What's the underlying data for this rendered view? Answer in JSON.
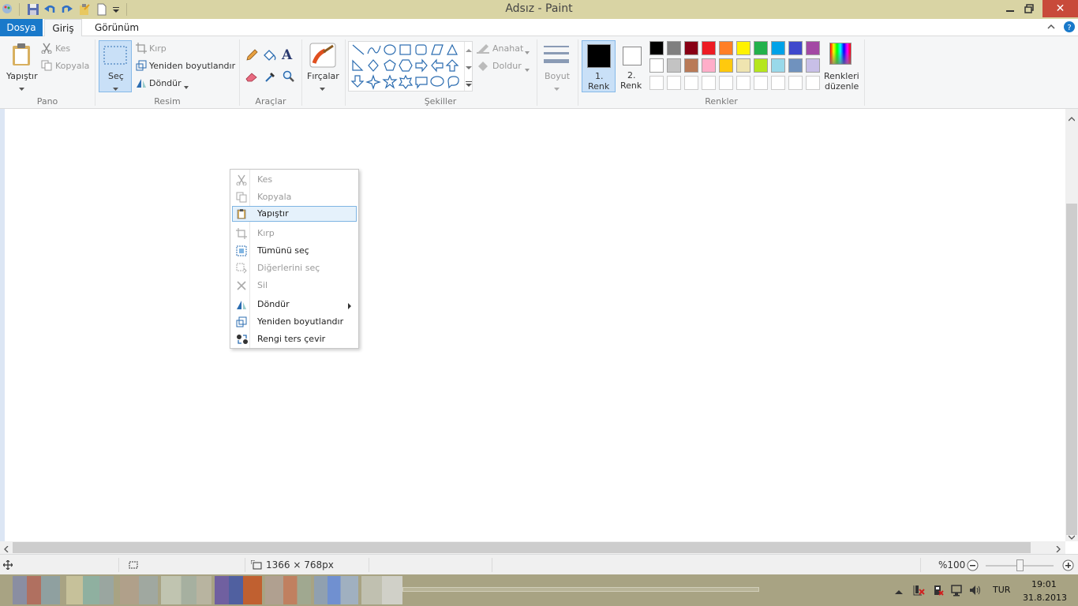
{
  "window": {
    "title": "Adsız - Paint"
  },
  "tabs": {
    "file": "Dosya",
    "home": "Giriş",
    "view": "Görünüm"
  },
  "ribbon": {
    "clipboard": {
      "paste": "Yapıştır",
      "cut": "Kes",
      "copy": "Kopyala",
      "group": "Pano"
    },
    "image": {
      "select": "Seç",
      "crop": "Kırp",
      "resize": "Yeniden boyutlandır",
      "rotate": "Döndür",
      "group": "Resim"
    },
    "tools": {
      "group": "Araçlar"
    },
    "brushes": {
      "label": "Fırçalar"
    },
    "shapes": {
      "outline": "Anahat",
      "fill": "Doldur",
      "group": "Şekiller"
    },
    "size": {
      "label": "Boyut"
    },
    "colors": {
      "color1": "1.",
      "color1b": "Renk",
      "color2": "2.",
      "color2b": "Renk",
      "edit": "Renkleri",
      "edit2": "düzenle",
      "group": "Renkler",
      "row1": [
        "#000000",
        "#7f7f7f",
        "#880015",
        "#ed1c24",
        "#ff7f27",
        "#fff200",
        "#22b14c",
        "#00a2e8",
        "#3f48cc",
        "#a349a4"
      ],
      "row2": [
        "#ffffff",
        "#c3c3c3",
        "#b97a57",
        "#ffaec9",
        "#ffc90e",
        "#efe4b0",
        "#b5e61d",
        "#99d9ea",
        "#7092be",
        "#c8bfe7"
      ]
    }
  },
  "context_menu": {
    "items": [
      {
        "label": "Kes",
        "enabled": false
      },
      {
        "label": "Kopyala",
        "enabled": false
      },
      {
        "label": "Yapıştır",
        "enabled": true
      },
      {
        "label": "Kırp",
        "enabled": false
      },
      {
        "label": "Tümünü seç",
        "enabled": true
      },
      {
        "label": "Diğerlerini seç",
        "enabled": false
      },
      {
        "label": "Sil",
        "enabled": false
      },
      {
        "label": "Döndür",
        "enabled": true
      },
      {
        "label": "Yeniden boyutlandır",
        "enabled": true
      },
      {
        "label": "Rengi ters çevir",
        "enabled": true
      }
    ]
  },
  "status": {
    "size": "1366 × 768px",
    "zoom": "%100"
  },
  "taskbar": {
    "lang": "TUR",
    "time": "19:01",
    "date": "31.8.2013"
  }
}
